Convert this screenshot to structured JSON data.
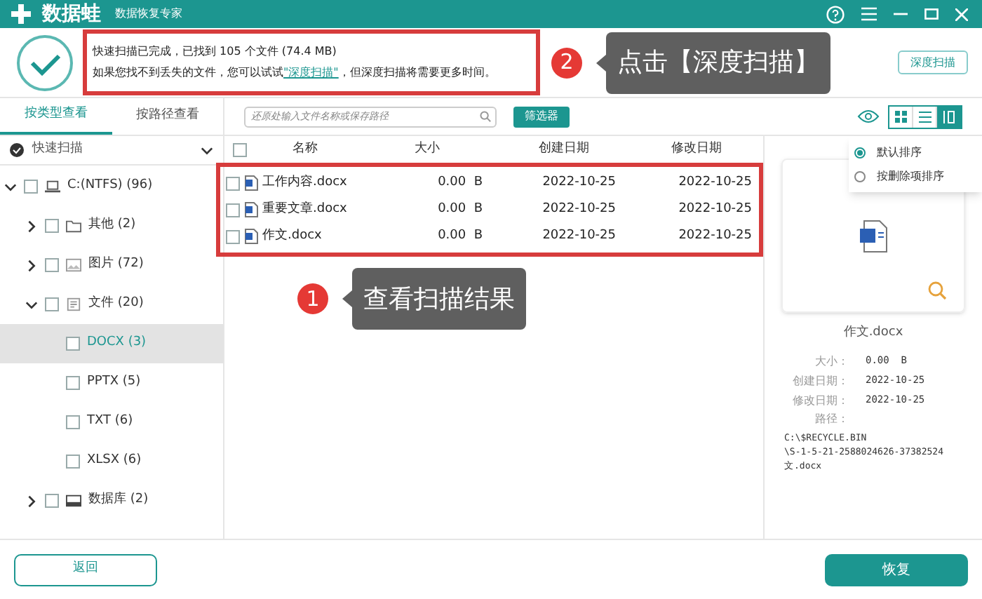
{
  "app": {
    "logo_text": "数据蛙",
    "subtitle": "数据恢复专家"
  },
  "scan_message": {
    "line1": "快速扫描已完成，已找到 105 个文件 (74.4 MB)",
    "line2_before": "如果您找不到丢失的文件，您可以试试",
    "line2_link": "\"深度扫描\"",
    "line2_after": "，但深度扫描将需要更多时间。"
  },
  "callouts": [
    {
      "number": "2",
      "text": "点击【深度扫描】"
    },
    {
      "number": "1",
      "text": "查看扫描结果"
    }
  ],
  "deep_scan_button": "深度扫描",
  "view_tabs": [
    {
      "label": "按类型查看",
      "selected": true
    },
    {
      "label": "按路径查看",
      "selected": false
    }
  ],
  "scan_mode": "快速扫描",
  "tree": [
    {
      "label": "C:(NTFS) (96)",
      "kind": "drive",
      "expanded": true,
      "checked": false,
      "selected": false,
      "children": [
        {
          "label": "其他 (2)",
          "kind": "folder",
          "expanded": false,
          "checked": false,
          "selected": false
        },
        {
          "label": "图片 (72)",
          "kind": "image",
          "expanded": false,
          "checked": false,
          "selected": false
        },
        {
          "label": "文件 (20)",
          "kind": "file",
          "expanded": true,
          "checked": false,
          "selected": false,
          "children": [
            {
              "label": "DOCX (3)",
              "checked": false,
              "selected": true
            },
            {
              "label": "PPTX (5)",
              "checked": false,
              "selected": false
            },
            {
              "label": "TXT (6)",
              "checked": false,
              "selected": false
            },
            {
              "label": "XLSX (6)",
              "checked": false,
              "selected": false
            }
          ]
        },
        {
          "label": "数据库 (2)",
          "kind": "database",
          "expanded": false,
          "checked": false,
          "selected": false
        }
      ]
    }
  ],
  "search": {
    "placeholder": "还原处输入文件名称或保存路径"
  },
  "filter_button": "筛选器",
  "view_modes": [
    {
      "kind": "grid",
      "selected": false
    },
    {
      "kind": "list",
      "selected": false
    },
    {
      "kind": "preview",
      "selected": true
    }
  ],
  "sort_options": [
    {
      "label": "默认排序",
      "selected": true
    },
    {
      "label": "按删除项排序",
      "selected": false
    }
  ],
  "table": {
    "all_checked": false,
    "columns": [
      "名称",
      "大小",
      "创建日期",
      "修改日期"
    ],
    "rows": [
      {
        "name": "工作内容.docx",
        "size": "0.00  B",
        "created": "2022-10-25",
        "modified": "2022-10-25",
        "checked": false
      },
      {
        "name": "重要文章.docx",
        "size": "0.00  B",
        "created": "2022-10-25",
        "modified": "2022-10-25",
        "checked": false
      },
      {
        "name": "作文.docx",
        "size": "0.00  B",
        "created": "2022-10-25",
        "modified": "2022-10-25",
        "checked": false
      }
    ]
  },
  "preview": {
    "file_name": "作文.docx",
    "details": [
      {
        "label": "大小：",
        "value": "0.00  B"
      },
      {
        "label": "创建日期：",
        "value": "2022-10-25"
      },
      {
        "label": "修改日期：",
        "value": "2022-10-25"
      }
    ],
    "path_label": "路径：",
    "path_lines": [
      "C:\\$RECYCLE.BIN",
      "\\S-1-5-21-2588024626-37382524",
      "文.docx"
    ]
  },
  "footer": {
    "back_button": "返回",
    "recover_button": "恢复"
  }
}
